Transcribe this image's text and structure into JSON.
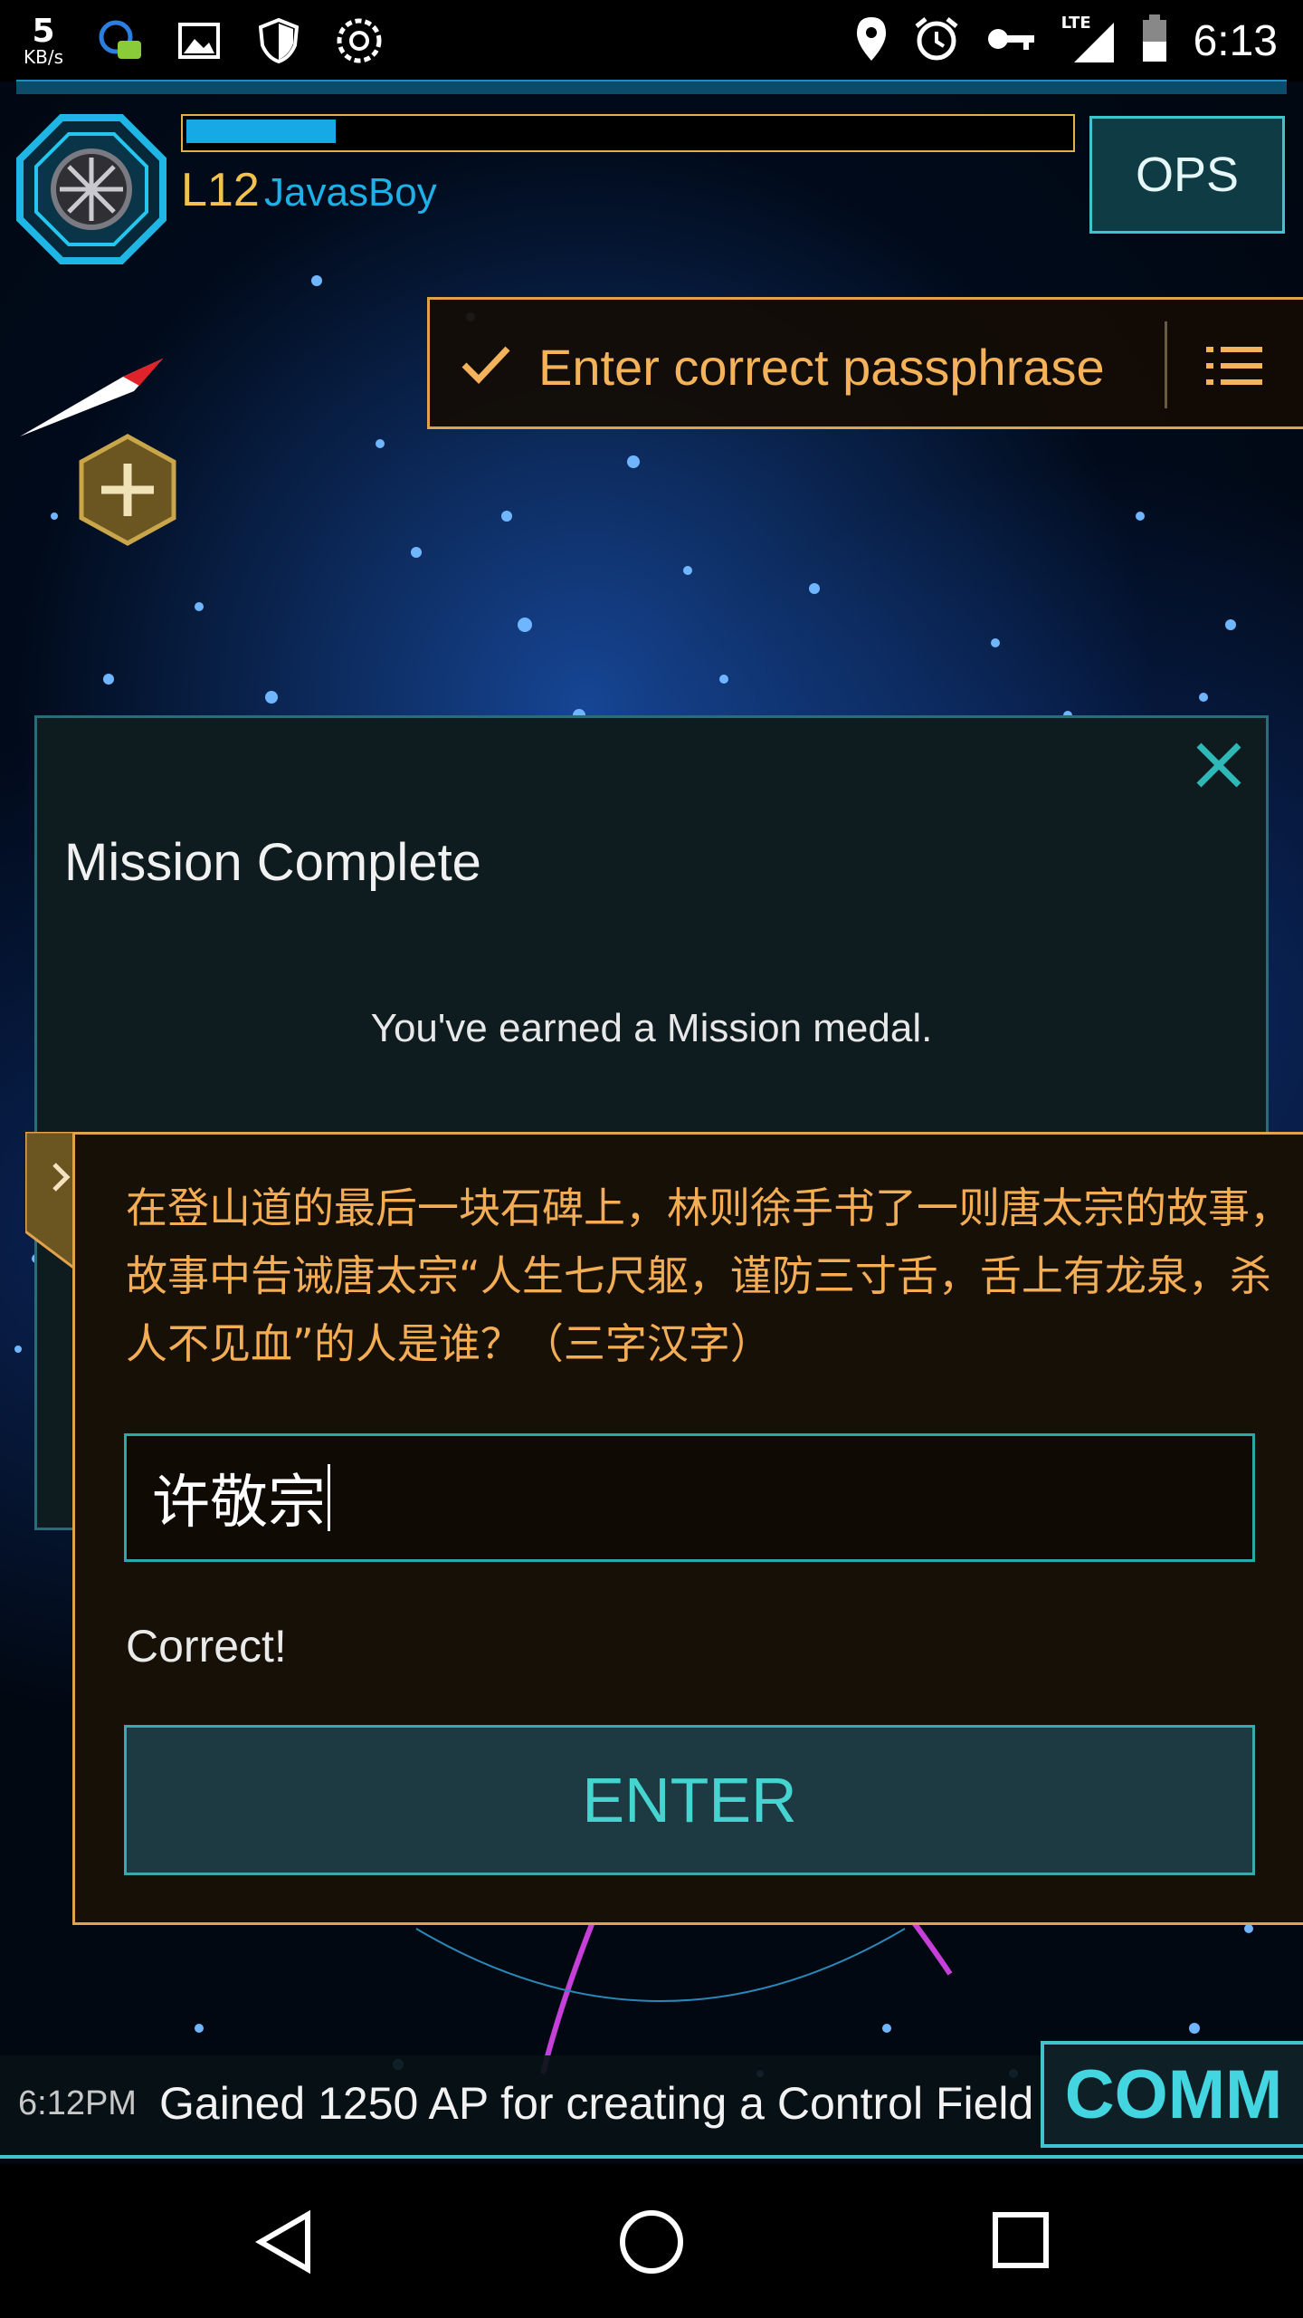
{
  "status_bar": {
    "net_speed_value": "5",
    "net_speed_unit": "KB/s",
    "network_label": "LTE",
    "time": "6:13",
    "icons": [
      "notification-chat-icon",
      "image-icon",
      "shield-icon",
      "settings-gear-icon",
      "location-icon",
      "alarm-icon",
      "key-icon",
      "signal-icon",
      "battery-icon"
    ]
  },
  "agent": {
    "level": "L12",
    "name": "JavasBoy",
    "xp_progress": 0.17,
    "level_color": "#f2c24e",
    "name_color": "#1fb0e8"
  },
  "ops_button": {
    "label": "OPS"
  },
  "task_banner": {
    "label": "Enter correct passphrase",
    "color": "#f4b35a"
  },
  "mission_dialog": {
    "title": "Mission Complete",
    "message": "You've earned a Mission medal."
  },
  "passphrase_dialog": {
    "question": "在登山道的最后一块石碑上，林则徐手书了一则唐太宗的故事，故事中告诫唐太宗“人生七尺躯，谨防三寸舌，舌上有龙泉，杀人不见血”的人是谁？（三字汉字）",
    "answer_value": "许敬宗",
    "result_text": "Correct!",
    "enter_label": "ENTER",
    "accent_color": "#e0a24c"
  },
  "comm": {
    "time": "6:12PM",
    "message": "Gained 1250 AP for creating a Control Field",
    "button_label": "COMM"
  },
  "nav_bar": {
    "buttons": [
      "back-icon",
      "home-icon",
      "recent-apps-icon"
    ]
  }
}
